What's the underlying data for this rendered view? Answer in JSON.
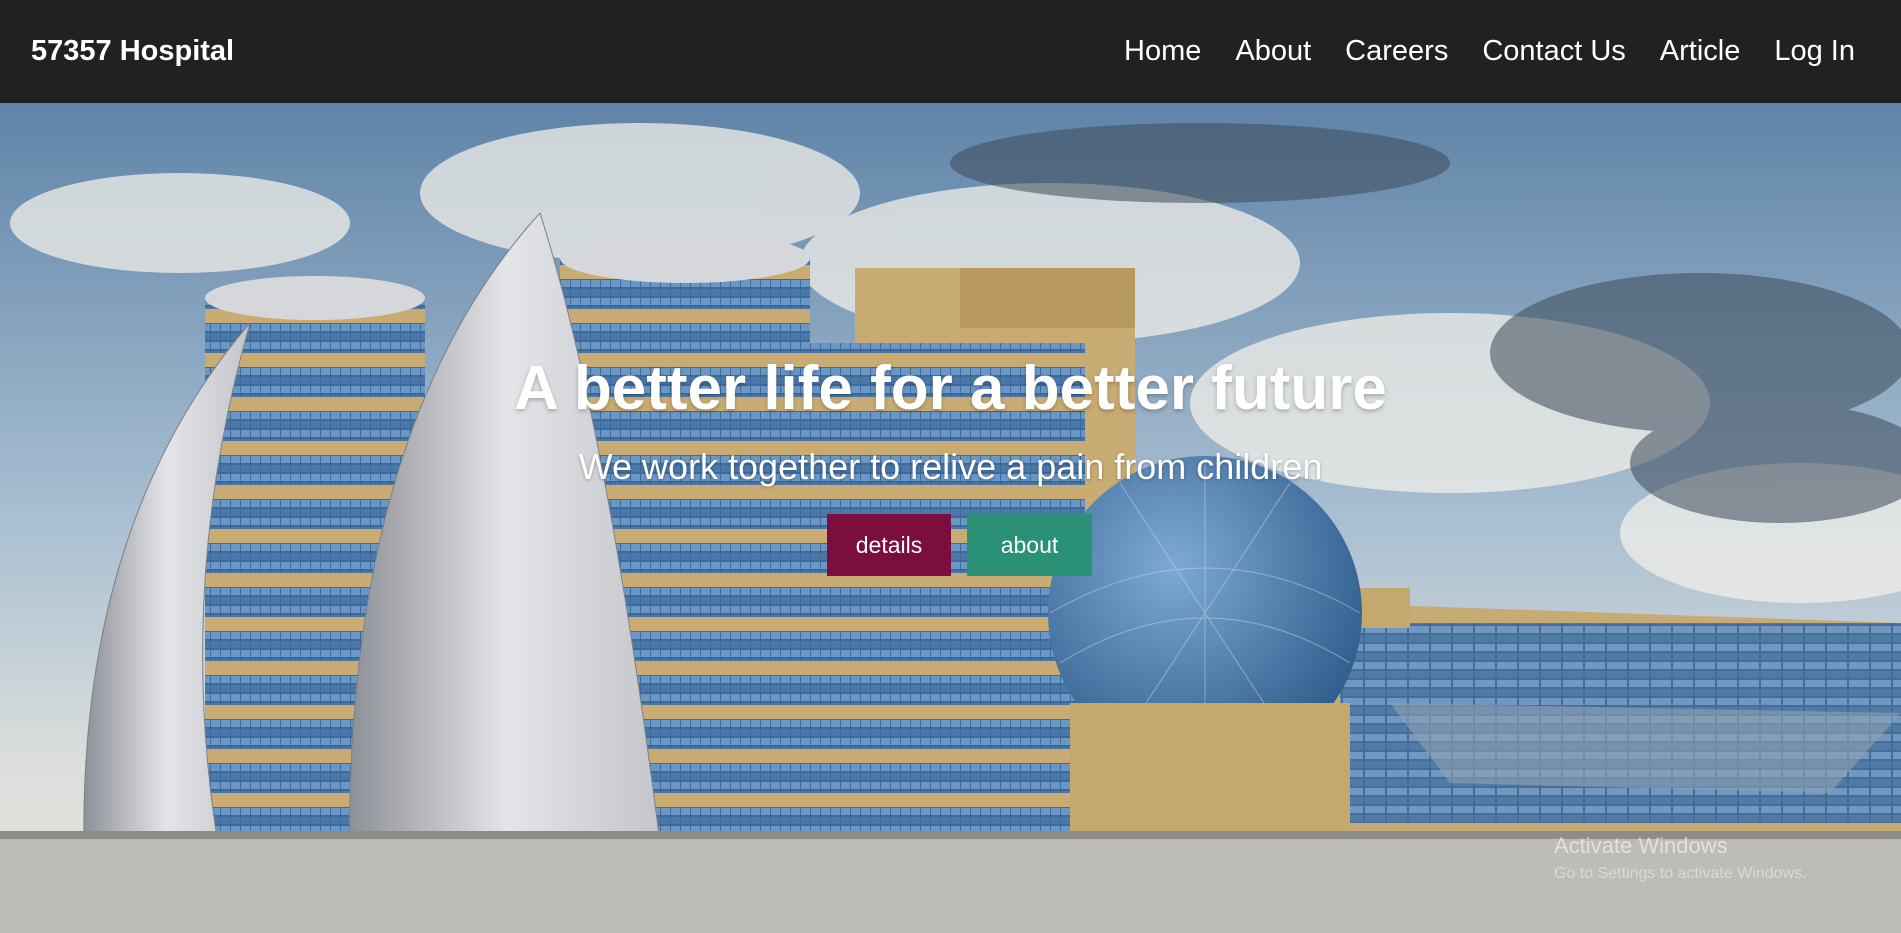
{
  "navbar": {
    "brand": "57357 Hospital",
    "links": [
      "Home",
      "About",
      "Careers",
      "Contact Us",
      "Article",
      "Log In"
    ]
  },
  "hero": {
    "title": "A better life for a better future",
    "subtitle": "We work together to relive a pain from children",
    "buttons": {
      "details": "details",
      "about": "about"
    },
    "image": "hospital-building-photo"
  },
  "watermark": {
    "title": "Activate Windows",
    "subtitle": "Go to Settings to activate Windows."
  },
  "colors": {
    "navbar_bg": "#212121",
    "details_button": "#7b0d3f",
    "about_button": "#2a9076"
  }
}
